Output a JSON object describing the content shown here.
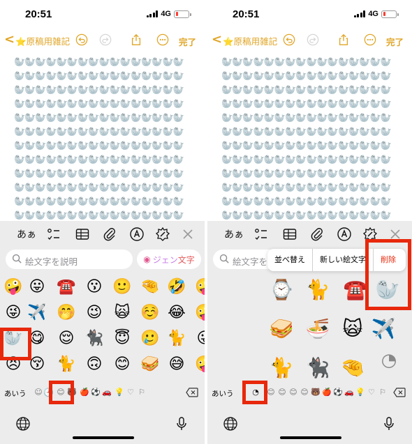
{
  "status": {
    "time": "20:51",
    "network": "4G"
  },
  "nav": {
    "back_glyph": "<",
    "title": "⭐原稿用雑記",
    "done_label": "完了"
  },
  "note_text": "🦭🦭🦭🦭🦭🦭🦭🦭🦭🦭🦭🦭🦭🦭🦭🦭🦭🦭🦭🦭🦭🦭🦭🦭🦭🦭🦭🦭🦭🦭🦭🦭🦭🦭🦭🦭🦭🦭🦭🦭🦭🦭🦭🦭🦭🦭🦭🦭🦭🦭🦭🦭🦭🦭🦭🦭🦭🦭🦭🦭🦭🦭🦭🦭🦭🦭🦭🦭🦭🦭🦭🦭🦭🦭🦭🦭🦭🦭🦭🦭🦭🦭🦭🦭🦭🦭🦭🦭🦭🦭🦭🦭🦭🦭🦭🦭🦭🦭🦭🦭🦭🦭🦭🦭🦭🦭🦭🦭🦭🦭🦭🦭🦭🦭🦭🦭🦭🦭🦭🦭🦭🦭🦭🦭🦭🦭🦭🦭🦭🦭🦭🦭🦭🦭🦭🦭🦭🦭🦭🦭🦭🦭🦭🦭🦭🦭🦭🦭🦭🦭🦭🦭🦭🦭🦭🦭🦭🦭🦭🦭🦭🦭🦭🦭🦭🦭🦭🦭🦭🦭🦭🦭🦭🦭🦭🦭🦭🦭🦭🦭🦭🦭🦭🦭🦭🦭🦭🦭🦭🦭🦭🦭🦭🦭🦭🦭🦭🦭🦭🦭🦭🦭🦭🦭",
  "keyboard": {
    "format_label": "あぁ",
    "search_placeholder": "絵文字を説明",
    "genmoji": {
      "part1": "ジェン",
      "part2": "文字"
    },
    "category_abc": "あいう",
    "left_emoji_rows": [
      [
        "🤪",
        "😛",
        "☎️",
        "😗",
        "🙂",
        "🤏",
        "🤣",
        "🤪"
      ],
      [
        "😜",
        "✈️",
        "🤭",
        "😉",
        "🙀",
        "☺️",
        "😂",
        "🤪"
      ],
      [
        "🦭",
        "😋",
        "😌",
        "🐈‍⬛",
        "😇",
        "🥲",
        "🐈",
        "😛"
      ],
      [
        "😣",
        "😚",
        "🐈",
        "🙃",
        "😊",
        "🥪",
        "😅",
        "🤪"
      ]
    ],
    "left_categories": [
      "☺",
      "🕘",
      "😊",
      "🐻",
      "🍎",
      "⚽",
      "🚗",
      "💡",
      "♡",
      "⚐"
    ],
    "right_categories": [
      "😊",
      "😊",
      "😊",
      "😊",
      "🐻",
      "🍎",
      "⚽",
      "🚗",
      "💡",
      "♡",
      "⚐"
    ],
    "stickers": [
      {
        "sym": "⌚"
      },
      {
        "sym": "🐈"
      },
      {
        "sym": "☎️"
      },
      {
        "sym": "🦭"
      },
      {
        "sym": "🥪"
      },
      {
        "sym": "🍜"
      },
      {
        "sym": "🙀"
      },
      {
        "sym": "✈️"
      },
      {
        "sym": "🐈"
      },
      {
        "sym": "🐈‍⬛"
      },
      {
        "sym": "🤏"
      }
    ]
  },
  "context_menu": {
    "rearrange": "並べ替え",
    "new_sticker": "新しい絵文字",
    "delete": "削除"
  },
  "colors": {
    "accent": "#E0A526",
    "highlight": "#E8280C",
    "keyboard_bg": "#ECECEC"
  }
}
